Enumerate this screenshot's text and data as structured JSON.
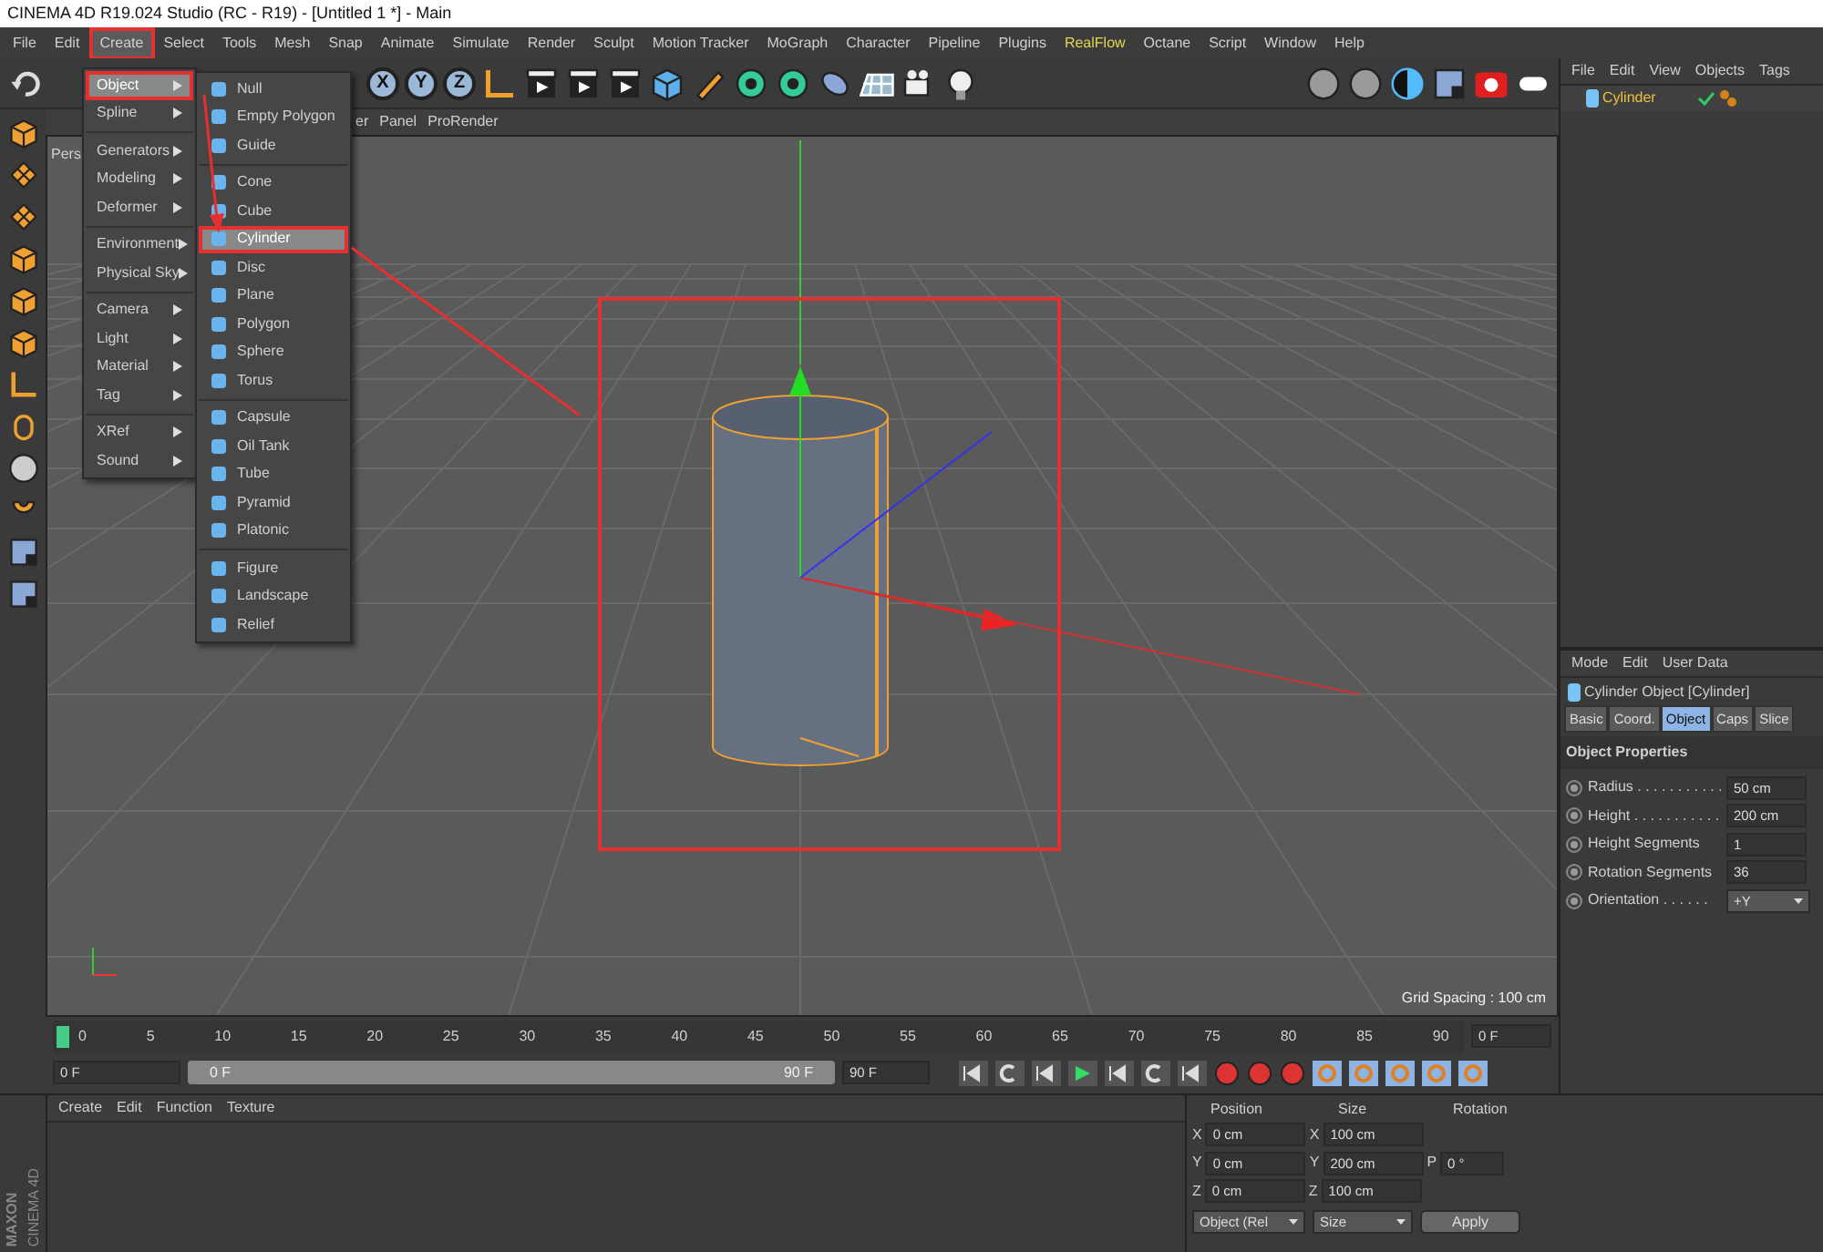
{
  "window": {
    "title": "CINEMA 4D R19.024 Studio (RC - R19) - [Untitled 1 *] - Main"
  },
  "menu_bar": [
    {
      "label": "File",
      "selected": false,
      "highlighted": false
    },
    {
      "label": "Edit",
      "selected": false,
      "highlighted": false
    },
    {
      "label": "Create",
      "selected": true,
      "highlighted": false
    },
    {
      "label": "Select",
      "selected": false,
      "highlighted": false
    },
    {
      "label": "Tools",
      "selected": false,
      "highlighted": false
    },
    {
      "label": "Mesh",
      "selected": false,
      "highlighted": false
    },
    {
      "label": "Snap",
      "selected": false,
      "highlighted": false
    },
    {
      "label": "Animate",
      "selected": false,
      "highlighted": false
    },
    {
      "label": "Simulate",
      "selected": false,
      "highlighted": false
    },
    {
      "label": "Render",
      "selected": false,
      "highlighted": false
    },
    {
      "label": "Sculpt",
      "selected": false,
      "highlighted": false
    },
    {
      "label": "Motion Tracker",
      "selected": false,
      "highlighted": false
    },
    {
      "label": "MoGraph",
      "selected": false,
      "highlighted": false
    },
    {
      "label": "Character",
      "selected": false,
      "highlighted": false
    },
    {
      "label": "Pipeline",
      "selected": false,
      "highlighted": false
    },
    {
      "label": "Plugins",
      "selected": false,
      "highlighted": false
    },
    {
      "label": "RealFlow",
      "selected": false,
      "highlighted": true
    },
    {
      "label": "Octane",
      "selected": false,
      "highlighted": false
    },
    {
      "label": "Script",
      "selected": false,
      "highlighted": false
    },
    {
      "label": "Window",
      "selected": false,
      "highlighted": false
    },
    {
      "label": "Help",
      "selected": false,
      "highlighted": false
    }
  ],
  "toolbar": {
    "axis_buttons": [
      "X",
      "Y",
      "Z"
    ]
  },
  "create_menu": {
    "groups": [
      [
        {
          "label": "Object",
          "selected": true
        },
        {
          "label": "Spline",
          "selected": false
        }
      ],
      [
        {
          "label": "Generators",
          "selected": false
        },
        {
          "label": "Modeling",
          "selected": false
        },
        {
          "label": "Deformer",
          "selected": false
        }
      ],
      [
        {
          "label": "Environment",
          "selected": false
        },
        {
          "label": "Physical Sky",
          "selected": false
        }
      ],
      [
        {
          "label": "Camera",
          "selected": false
        },
        {
          "label": "Light",
          "selected": false
        },
        {
          "label": "Material",
          "selected": false
        },
        {
          "label": "Tag",
          "selected": false
        }
      ],
      [
        {
          "label": "XRef",
          "selected": false
        },
        {
          "label": "Sound",
          "selected": false
        }
      ]
    ]
  },
  "object_submenu": {
    "groups": [
      [
        {
          "label": "Null",
          "selected": false
        },
        {
          "label": "Empty Polygon",
          "selected": false
        },
        {
          "label": "Guide",
          "selected": false
        }
      ],
      [
        {
          "label": "Cone",
          "selected": false
        },
        {
          "label": "Cube",
          "selected": false
        },
        {
          "label": "Cylinder",
          "selected": true
        },
        {
          "label": "Disc",
          "selected": false
        },
        {
          "label": "Plane",
          "selected": false
        },
        {
          "label": "Polygon",
          "selected": false
        },
        {
          "label": "Sphere",
          "selected": false
        },
        {
          "label": "Torus",
          "selected": false
        }
      ],
      [
        {
          "label": "Capsule",
          "selected": false
        },
        {
          "label": "Oil Tank",
          "selected": false
        },
        {
          "label": "Tube",
          "selected": false
        },
        {
          "label": "Pyramid",
          "selected": false
        },
        {
          "label": "Platonic",
          "selected": false
        }
      ],
      [
        {
          "label": "Figure",
          "selected": false
        },
        {
          "label": "Landscape",
          "selected": false
        },
        {
          "label": "Relief",
          "selected": false
        }
      ]
    ]
  },
  "viewport": {
    "menu": [
      "er",
      "Panel",
      "ProRender"
    ],
    "camera_label": "Pers",
    "grid_spacing": "Grid Spacing : 100 cm"
  },
  "timeline": {
    "ticks": [
      "0",
      "5",
      "10",
      "15",
      "20",
      "25",
      "30",
      "35",
      "40",
      "45",
      "50",
      "55",
      "60",
      "65",
      "70",
      "75",
      "80",
      "85",
      "90"
    ],
    "current_frame": "0 F",
    "start_field": "0 F",
    "range": {
      "start": "0 F",
      "end": "90 F",
      "level": 1
    },
    "end_field": "90 F"
  },
  "object_manager": {
    "menu": [
      "File",
      "Edit",
      "View",
      "Objects",
      "Tags"
    ],
    "objects": [
      {
        "name": "Cylinder",
        "selected": true
      }
    ]
  },
  "attributes": {
    "menu": [
      "Mode",
      "Edit",
      "User Data"
    ],
    "header": "Cylinder Object [Cylinder]",
    "tabs": [
      {
        "label": "Basic",
        "selected": false
      },
      {
        "label": "Coord.",
        "selected": false
      },
      {
        "label": "Object",
        "selected": true
      },
      {
        "label": "Caps",
        "selected": false
      },
      {
        "label": "Slice",
        "selected": false
      }
    ],
    "section": "Object Properties",
    "fields": [
      {
        "label": "Radius . . . . . . . . . . .",
        "value": "50 cm",
        "kind": "number"
      },
      {
        "label": "Height . . . . . . . . . . .",
        "value": "200 cm",
        "kind": "number"
      },
      {
        "label": "Height Segments",
        "value": "1",
        "kind": "number"
      },
      {
        "label": "Rotation Segments",
        "value": "36",
        "kind": "number"
      },
      {
        "label": "Orientation . . . . . .",
        "value": "+Y",
        "kind": "dropdown"
      }
    ]
  },
  "material_manager": {
    "menu": [
      "Create",
      "Edit",
      "Function",
      "Texture"
    ]
  },
  "coordinates": {
    "headers": [
      "Position",
      "Size",
      "Rotation"
    ],
    "rows": [
      {
        "axis": "X",
        "position": "0 cm",
        "size_axis": "X",
        "size": "100 cm"
      },
      {
        "axis": "Y",
        "position": "0 cm",
        "size_axis": "Y",
        "size": "200 cm",
        "rotation_axis": "P",
        "rotation": "0 °"
      },
      {
        "axis": "Z",
        "position": "0 cm",
        "size_axis": "Z",
        "size": "100 cm"
      }
    ],
    "mode_dropdown": "Object (Rel",
    "size_dropdown": "Size",
    "apply_button": "Apply"
  },
  "logo": {
    "brand": "MAXON",
    "product": "CINEMA 4D"
  }
}
